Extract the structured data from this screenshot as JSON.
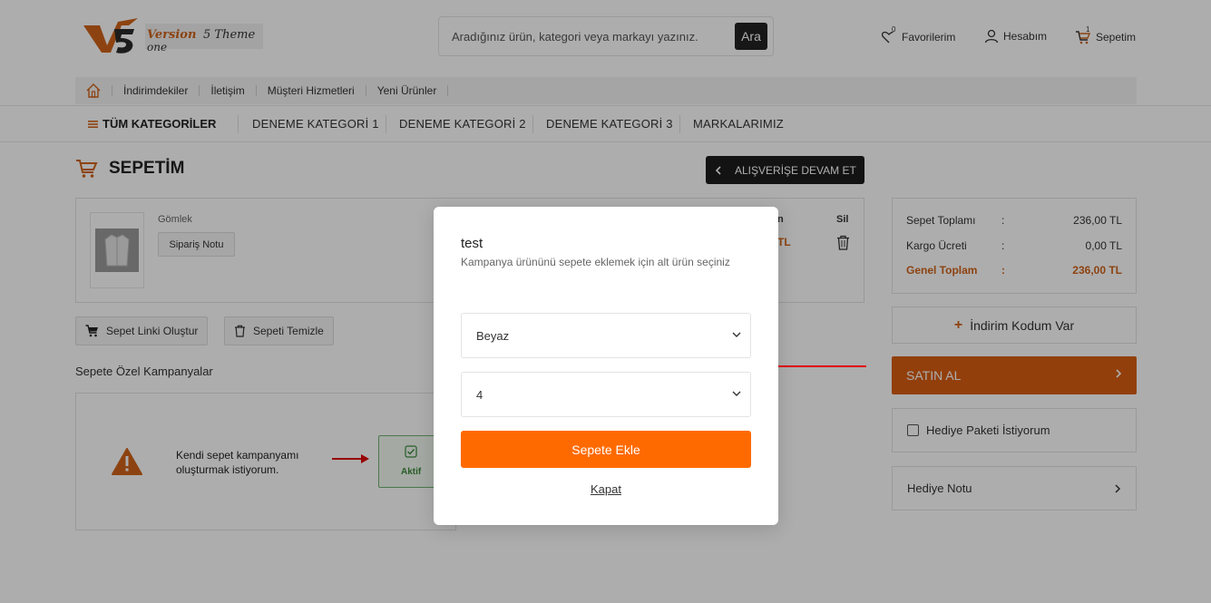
{
  "header": {
    "logo": {
      "line1_a": "Version",
      "line1_b": "5 Theme",
      "line2": "one"
    },
    "search": {
      "placeholder": "Aradığınız ürün, kategori veya markayı yazınız.",
      "button": "Ara"
    },
    "links": {
      "favorites": "Favorilerim",
      "favorites_count": "0",
      "account": "Hesabım",
      "cart": "Sepetim",
      "cart_count": "1"
    }
  },
  "topnav": {
    "items": [
      "İndirimdekiler",
      "İletişim",
      "Müşteri Hizmetleri",
      "Yeni Ürünler"
    ]
  },
  "catnav": {
    "all": "TÜM KATEGORİLER",
    "items": [
      "DENEME KATEGORİ 1",
      "DENEME KATEGORİ 2",
      "DENEME KATEGORİ 3",
      "MARKALARIMIZ"
    ]
  },
  "cart": {
    "title": "SEPETİM",
    "continue": "ALIŞVERİŞE DEVAM ET",
    "product": {
      "name": "Gömlek",
      "order_note": "Sipariş Notu"
    },
    "col_fragment": "n",
    "price_fragment": "TL",
    "remove_head": "Sil",
    "create_link": "Sepet Linki Oluştur",
    "clear": "Sepeti Temizle",
    "campaigns_title": "Sepete Özel Kampanyalar",
    "campaign_text": "Kendi sepet kampanyamı oluşturmak istiyorum.",
    "campaign_badge": "Aktif"
  },
  "summary": {
    "subtotal_label": "Sepet Toplamı",
    "subtotal": "236,00 TL",
    "shipping_label": "Kargo Ücreti",
    "shipping": "0,00 TL",
    "total_label": "Genel Toplam",
    "total": "236,00 TL",
    "colon": ":",
    "discount": "İndirim Kodum Var",
    "buy": "SATIN AL",
    "gift_package": "Hediye Paketi İstiyorum",
    "gift_note": "Hediye Notu"
  },
  "modal": {
    "title": "test",
    "subtitle": "Kampanya ürününü sepete eklemek için alt ürün seçiniz",
    "select1_value": "Beyaz",
    "select2_value": "4",
    "add_button": "Sepete Ekle",
    "close": "Kapat"
  },
  "colors": {
    "accent": "#d85e12",
    "modal_button": "#ff6a00",
    "overlay": "rgba(0,0,0,0.32)",
    "arrow": "#e00000"
  },
  "icons": [
    "logo-v5-icon",
    "heart-icon",
    "user-icon",
    "cart-icon",
    "home-icon",
    "menu-icon",
    "chevron-left-icon",
    "shirt-icon",
    "trash-icon",
    "warning-icon",
    "checkbox-checked-icon",
    "plus-icon",
    "chevron-right-icon",
    "chevron-down-icon",
    "red-arrow-icon"
  ]
}
